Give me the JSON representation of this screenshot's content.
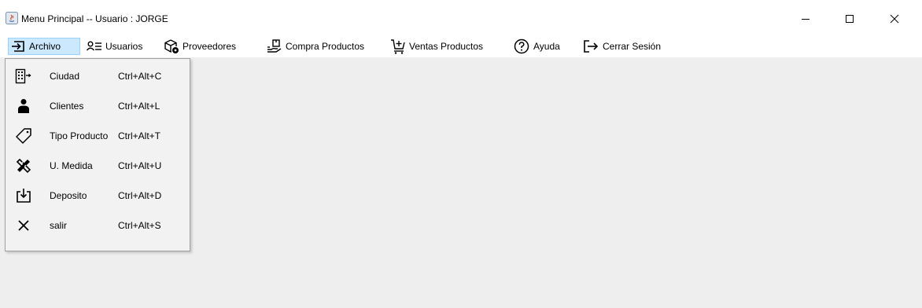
{
  "window": {
    "title": "Menu Principal -- Usuario : JORGE"
  },
  "menubar": {
    "items": [
      {
        "label": "Archivo",
        "icon": "login-box-icon",
        "active": true
      },
      {
        "label": "Usuarios",
        "icon": "user-list-icon"
      },
      {
        "label": "Proveedores",
        "icon": "box-gear-icon"
      },
      {
        "label": "Compra Productos",
        "icon": "hand-box-icon"
      },
      {
        "label": "Ventas Productos",
        "icon": "cart-plus-icon"
      },
      {
        "label": "Ayuda",
        "icon": "help-circle-icon"
      },
      {
        "label": "Cerrar Sesión",
        "icon": "logout-icon"
      }
    ]
  },
  "archivo_menu": {
    "items": [
      {
        "label": "Ciudad",
        "accelerator": "Ctrl+Alt+C",
        "icon": "building-arrow-icon"
      },
      {
        "label": "Clientes",
        "accelerator": "Ctrl+Alt+L",
        "icon": "person-icon"
      },
      {
        "label": "Tipo Producto",
        "accelerator": "Ctrl+Alt+T",
        "icon": "tag-icon"
      },
      {
        "label": "U. Medida",
        "accelerator": "Ctrl+Alt+U",
        "icon": "ruler-pencil-icon"
      },
      {
        "label": "Deposito",
        "accelerator": "Ctrl+Alt+D",
        "icon": "download-tray-icon"
      },
      {
        "label": "salir",
        "accelerator": "Ctrl+Alt+S",
        "icon": "close-icon"
      }
    ]
  },
  "colors": {
    "menu_highlight": "#cce8ff",
    "menu_highlight_border": "#99d1ff",
    "content_background": "#eeeeee",
    "dropdown_background": "#f2f2f2"
  }
}
